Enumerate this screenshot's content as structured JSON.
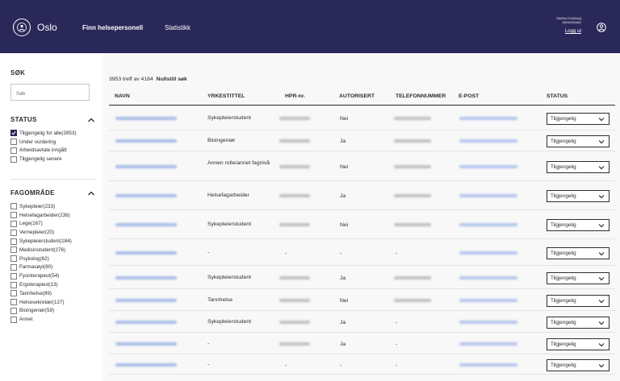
{
  "header": {
    "logo_text": "Oslo",
    "nav": {
      "active": "Finn helsepersonell",
      "statistics": "Statistikk"
    },
    "user": {
      "name": "Martha Fredheug",
      "role": "Administrator",
      "logout": "Logg ut"
    }
  },
  "sidebar": {
    "search": {
      "title": "SØK",
      "placeholder": "Søk"
    },
    "status": {
      "title": "STATUS",
      "items": [
        {
          "label": "Tilgjengelig for alle",
          "count": "(3953)",
          "checked": true
        },
        {
          "label": "Under vurdering",
          "count": "",
          "checked": false
        },
        {
          "label": "Arbeidsavtale inngått",
          "count": "",
          "checked": false
        },
        {
          "label": "Tilgjengelig senere",
          "count": "",
          "checked": false
        }
      ]
    },
    "fagomrade": {
      "title": "FAGOMRÅDE",
      "items": [
        {
          "label": "Sykepleier",
          "count": "(233)"
        },
        {
          "label": "Helsefagarbeider",
          "count": "(236)"
        },
        {
          "label": "Lege",
          "count": "(167)"
        },
        {
          "label": "Vernepleier",
          "count": "(20)"
        },
        {
          "label": "Sykepleierstudent",
          "count": "(184)"
        },
        {
          "label": "Medisinstudent",
          "count": "(276)"
        },
        {
          "label": "Psykolog",
          "count": "(62)"
        },
        {
          "label": "Farmasøyt",
          "count": "(80)"
        },
        {
          "label": "Fysioterapeut",
          "count": "(54)"
        },
        {
          "label": "Ergoterapeut",
          "count": "(13)"
        },
        {
          "label": "Tannhelse",
          "count": "(89)"
        },
        {
          "label": "Helsesekretær",
          "count": "(127)"
        },
        {
          "label": "Bioingeniør",
          "count": "(59)"
        },
        {
          "label": "Annet",
          "count": ""
        }
      ]
    }
  },
  "results": {
    "count_text": "3953 treff av 4184",
    "reset_label": "Nullstill søk"
  },
  "table": {
    "headers": [
      "NAVN",
      "YRKESTITTEL",
      "HPR-nr.",
      "AUTORISERT",
      "TELEFONNUMMER",
      "E-POST",
      "STATUS"
    ],
    "rows": [
      {
        "title": "Sykepleierstudent",
        "hpr": true,
        "autorisert": "Nei",
        "tel": true,
        "status": "Tilgjengelig"
      },
      {
        "title": "Bioingeniør",
        "hpr": true,
        "autorisert": "Ja",
        "tel": true,
        "status": "Tilgjengelig"
      },
      {
        "title": "Annen rolle/annet fagnivå",
        "hpr": true,
        "autorisert": "Nei",
        "tel": true,
        "status": "Tilgjengelig"
      },
      {
        "title": "Helsefagarbeider",
        "hpr": true,
        "autorisert": "Ja",
        "tel": true,
        "status": "Tilgjengelig"
      },
      {
        "title": "Sykepleierstudent",
        "hpr": true,
        "autorisert": "Nei",
        "tel": true,
        "status": "Tilgjengelig"
      },
      {
        "title": "-",
        "hpr": false,
        "hpr_text": "-",
        "autorisert": "-",
        "tel": false,
        "tel_text": "-",
        "status": "Tilgjengelig"
      },
      {
        "title": "Sykepleierstudent",
        "hpr": true,
        "autorisert": "Ja",
        "tel": true,
        "status": "Tilgjengelig"
      },
      {
        "title": "Tannhelse",
        "hpr": true,
        "autorisert": "Nei",
        "tel": true,
        "status": "Tilgjengelig"
      },
      {
        "title": "Sykepleierstudent",
        "hpr": true,
        "autorisert": "Ja",
        "tel": false,
        "tel_text": "-",
        "status": "Tilgjengelig"
      },
      {
        "title": "-",
        "hpr": true,
        "autorisert": "Ja",
        "tel": false,
        "tel_text": "-",
        "status": "Tilgjengelig"
      },
      {
        "title": "-",
        "hpr": false,
        "hpr_text": "-",
        "autorisert": "-",
        "tel": false,
        "tel_text": "-",
        "status": "Tilgjengelig"
      }
    ]
  },
  "colors": {
    "header_bg": "#2a2859",
    "link_blur": "#a8bce6",
    "text": "#2c2c2c"
  }
}
